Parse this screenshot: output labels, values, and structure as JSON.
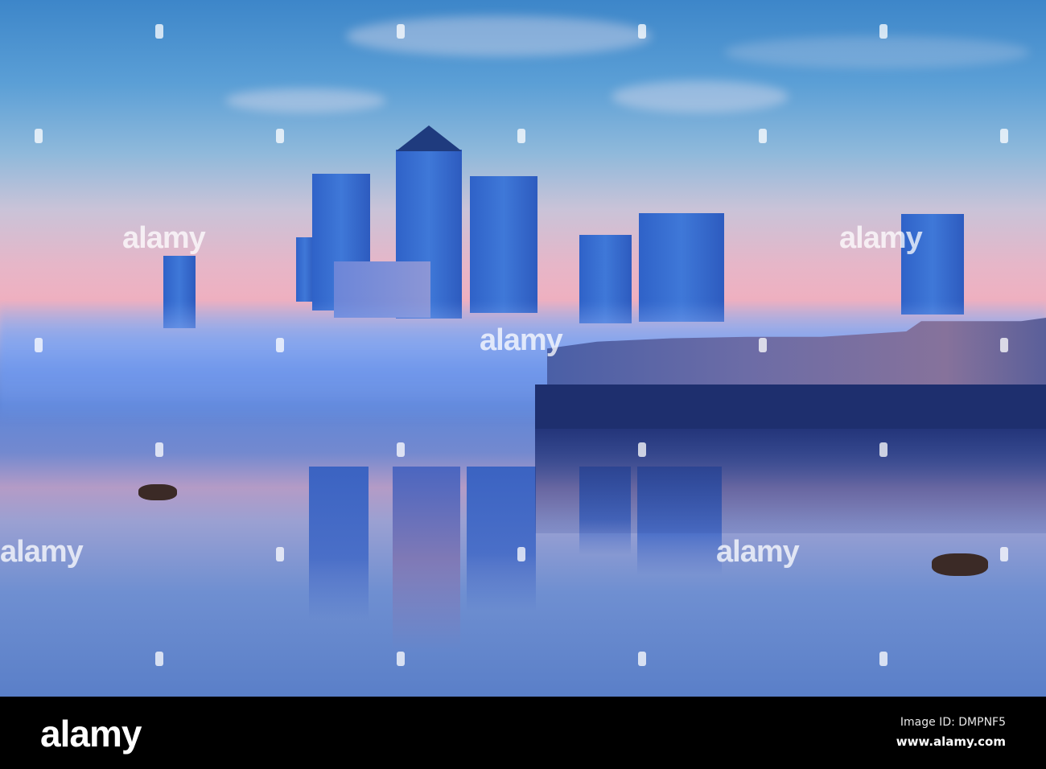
{
  "watermark": "alamy",
  "footer": {
    "logo": "alamy",
    "image_id": "Image ID: DMPNF5",
    "url": "www.alamy.com"
  }
}
